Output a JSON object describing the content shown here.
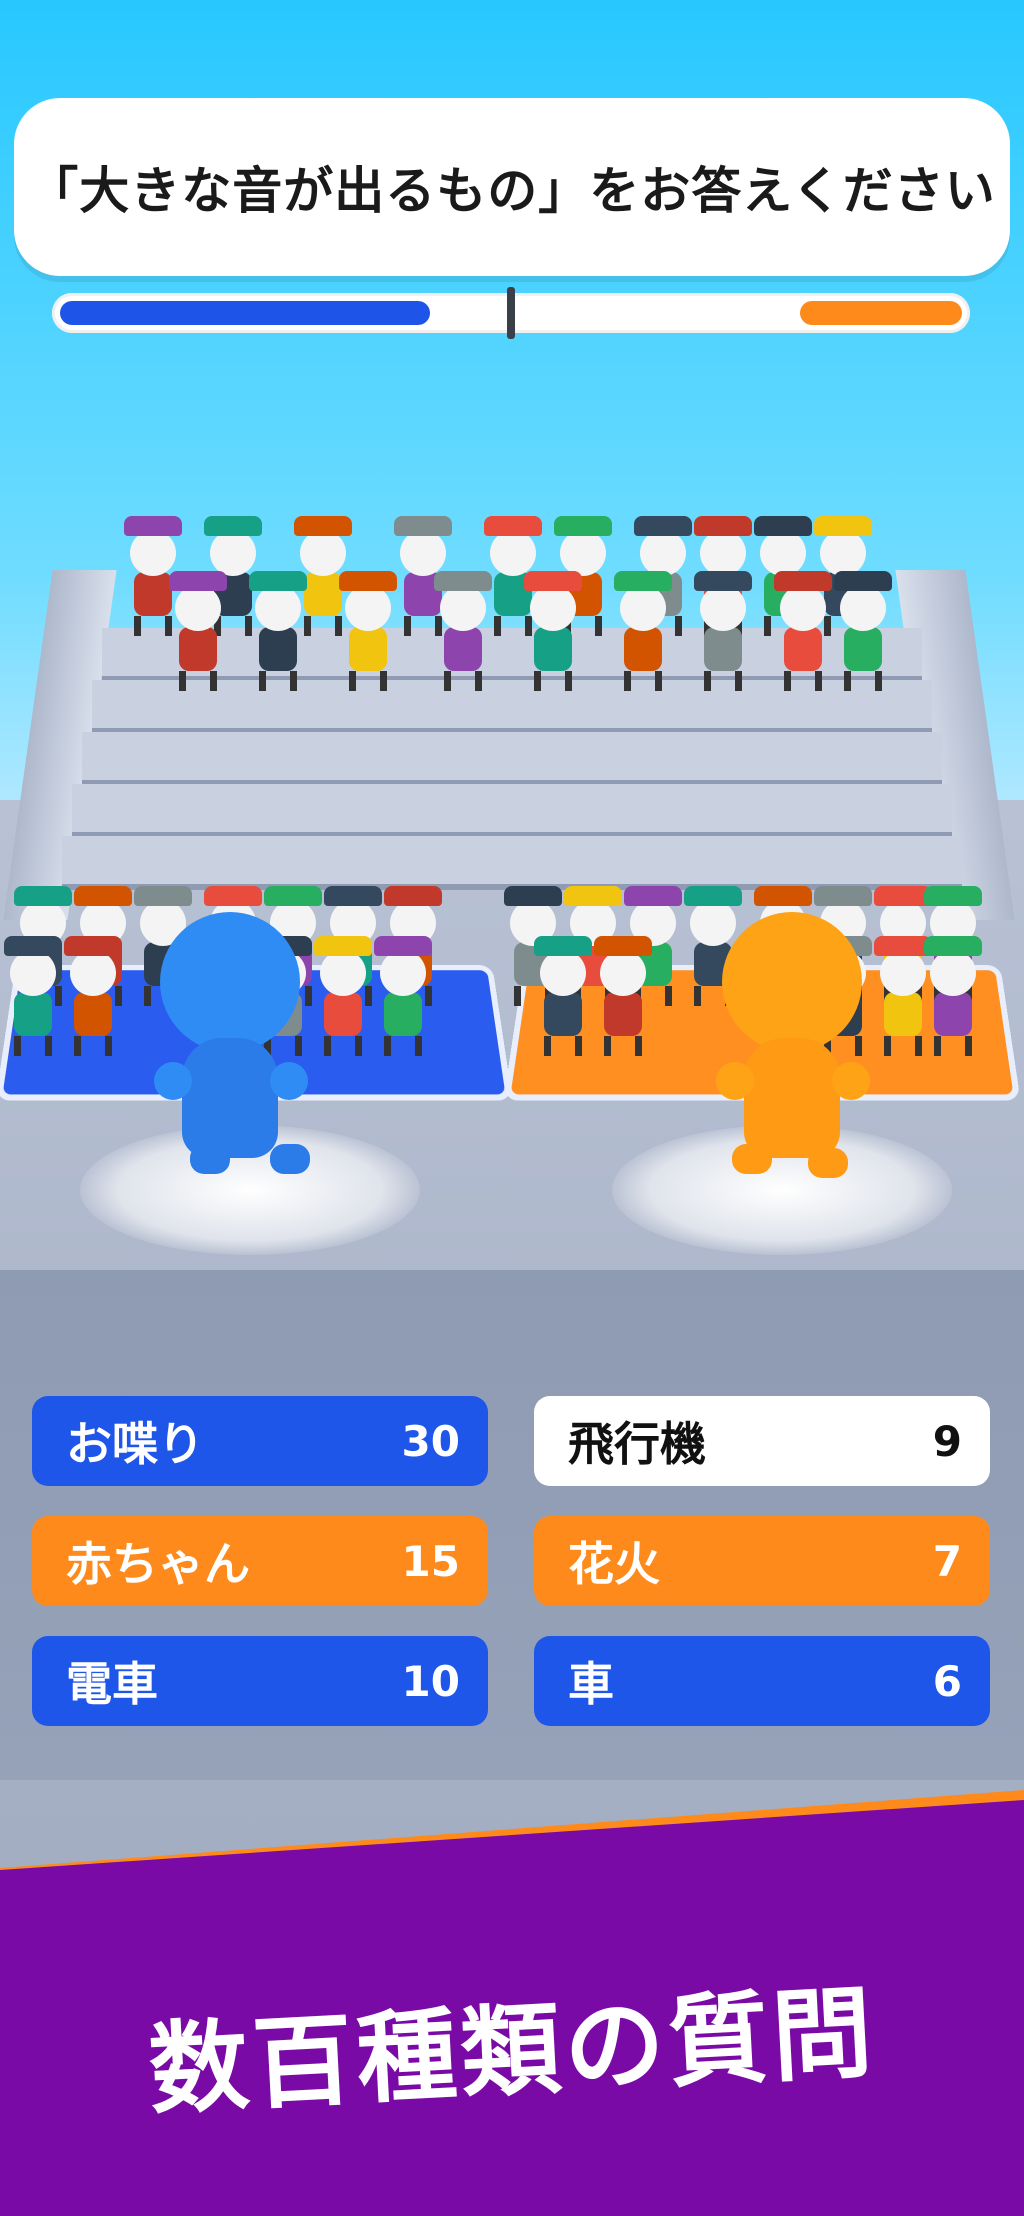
{
  "question": {
    "text": "「大きな音が出るもの」をお答えください"
  },
  "score_bar": {
    "blue_fraction": 0.41,
    "orange_fraction": 0.18,
    "blue_color": "#1e55e8",
    "orange_color": "#ff8a1c"
  },
  "answers": [
    {
      "label": "お喋り",
      "count": "30",
      "team": "blue"
    },
    {
      "label": "飛行機",
      "count": "9",
      "team": "none"
    },
    {
      "label": "赤ちゃん",
      "count": "15",
      "team": "orange"
    },
    {
      "label": "花火",
      "count": "7",
      "team": "orange"
    },
    {
      "label": "電車",
      "count": "10",
      "team": "blue"
    },
    {
      "label": "車",
      "count": "6",
      "team": "blue"
    }
  ],
  "footer": {
    "title": "数百種類の質問"
  },
  "colors": {
    "blue_team": "#2b5cf0",
    "orange_team": "#ff8f21",
    "footer_purple": "#7a0aa5"
  }
}
